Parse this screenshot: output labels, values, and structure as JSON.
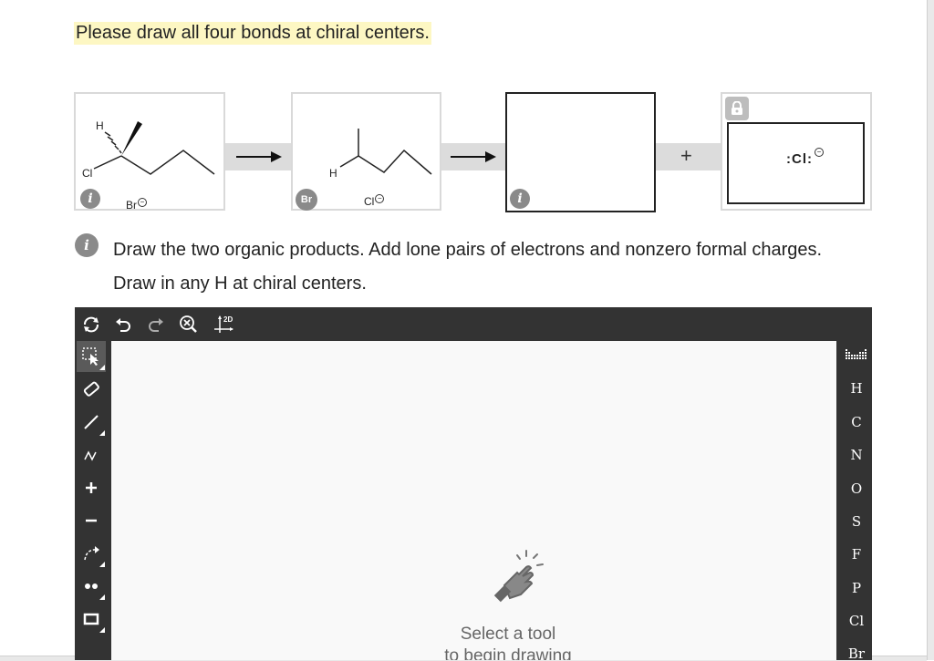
{
  "instruction": "Please draw all four bonds at chiral centers.",
  "reactant": {
    "labels": {
      "h": "H",
      "cl": "Cl",
      "br": "Br"
    }
  },
  "intermediate": {
    "labels": {
      "h": "H",
      "br": "Br",
      "cl": "Cl"
    }
  },
  "plus_sign": "+",
  "product_locked": {
    "label": ":Cl:"
  },
  "question": "Draw the two organic products. Add lone pairs of electrons and nonzero formal charges. Draw in any H at chiral centers.",
  "toolbar": {
    "zoom_label": "2D"
  },
  "elements": [
    "H",
    "C",
    "N",
    "O",
    "S",
    "F",
    "P",
    "Cl",
    "Br"
  ],
  "canvas_hint": {
    "line1": "Select a tool",
    "line2": "to begin drawing"
  },
  "colors": {
    "highlight": "#fdf7c3",
    "editor_bg": "#333333",
    "info_badge": "#8a8a8a"
  }
}
